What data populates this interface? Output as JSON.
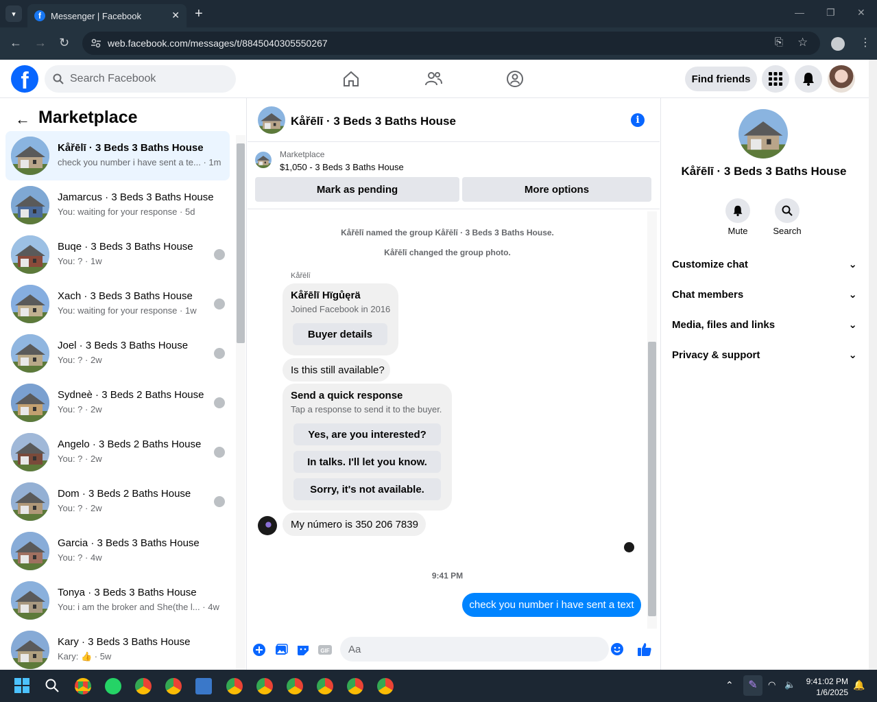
{
  "browser": {
    "tab_title": "Messenger | Facebook",
    "url": "web.facebook.com/messages/t/8845040305550267"
  },
  "fb_header": {
    "search_placeholder": "Search Facebook",
    "find_friends": "Find friends"
  },
  "marketplace": {
    "title": "Marketplace",
    "conversations": [
      {
        "name": "Kåřēlī · 3 Beds 3 Baths House",
        "preview": "check you number i have sent a te...",
        "time": "1m",
        "active": true
      },
      {
        "name": "Jamarcus · 3 Beds 3 Baths House",
        "preview": "You: waiting for your response",
        "time": "5d"
      },
      {
        "name": "Buqe · 3 Beds 3 Baths House",
        "preview": "You: ?",
        "time": "1w"
      },
      {
        "name": "Xach · 3 Beds 3 Baths House",
        "preview": "You: waiting for your response",
        "time": "1w"
      },
      {
        "name": "Joel · 3 Beds 3 Baths House",
        "preview": "You: ?",
        "time": "2w"
      },
      {
        "name": "Sydneè · 3 Beds 2 Baths House",
        "preview": "You: ?",
        "time": "2w"
      },
      {
        "name": "Angelo · 3 Beds 2 Baths House",
        "preview": "You: ?",
        "time": "2w"
      },
      {
        "name": "Dom · 3 Beds 2 Baths House",
        "preview": "You: ?",
        "time": "2w"
      },
      {
        "name": "Garcia · 3 Beds 3 Baths House",
        "preview": "You: ?",
        "time": "4w"
      },
      {
        "name": "Tonya · 3 Beds 3 Baths House",
        "preview": "You: i am the broker and She(the l...",
        "time": "4w"
      },
      {
        "name": "Kary · 3 Beds 3 Baths House",
        "preview": "Kary: 👍",
        "time": "5w"
      }
    ]
  },
  "chat": {
    "title": "Kåřēlī · 3 Beds 3 Baths House",
    "marketplace_label": "Marketplace",
    "listing": "$1,050 - 3 Beds 3 Baths House",
    "mark_pending": "Mark as pending",
    "more_options": "More options",
    "system_1": "Kåřēlī named the group Kåřēlī · 3 Beds 3 Baths House.",
    "system_2": "Kåřēlī changed the group photo.",
    "sender": "Kåřēlī",
    "card_name": "Kåřēlī Hïgůęrä",
    "card_sub": "Joined Facebook in 2016",
    "buyer_details": "Buyer details",
    "msg_available": "Is this still available?",
    "quick_title": "Send a quick response",
    "quick_sub": "Tap a response to send it to the buyer.",
    "quick_1": "Yes, are you interested?",
    "quick_2": "In talks. I'll let you know.",
    "quick_3": "Sorry, it's not available.",
    "msg_number": "My número is 350 206 7839",
    "timestamp": "9:41 PM",
    "out_msg": "check you number i have sent a text",
    "input_placeholder": "Aa"
  },
  "right_panel": {
    "name": "Kåřēlī · 3 Beds 3 Baths House",
    "mute": "Mute",
    "search": "Search",
    "sections": [
      "Customize chat",
      "Chat members",
      "Media, files and links",
      "Privacy & support"
    ]
  },
  "taskbar": {
    "time": "9:41:02 PM",
    "date": "1/6/2025"
  },
  "colors": {
    "brand": "#0866ff",
    "outgoing_bubble": "#0084ff",
    "active_conv": "#ebf5ff"
  }
}
